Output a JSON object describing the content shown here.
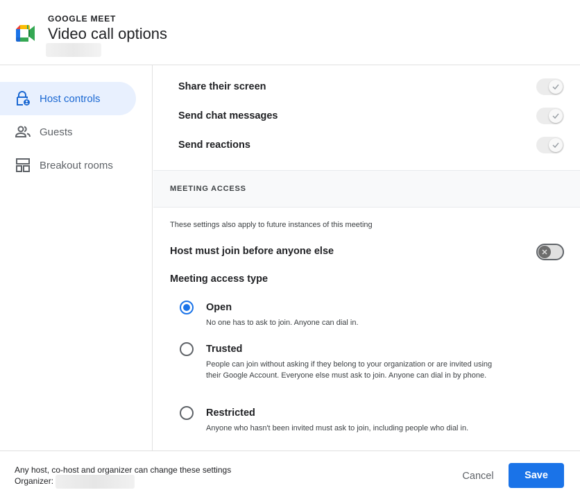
{
  "header": {
    "brand": "GOOGLE MEET",
    "title": "Video call options"
  },
  "sidebar": {
    "items": [
      {
        "label": "Host controls",
        "icon": "lock-person-icon",
        "active": true
      },
      {
        "label": "Guests",
        "icon": "people-icon",
        "active": false
      },
      {
        "label": "Breakout rooms",
        "icon": "grid-icon",
        "active": false
      }
    ]
  },
  "permissions": [
    {
      "label": "Share their screen",
      "enabled": true
    },
    {
      "label": "Send chat messages",
      "enabled": true
    },
    {
      "label": "Send reactions",
      "enabled": true
    }
  ],
  "meeting_access": {
    "section_title": "MEETING ACCESS",
    "note": "These settings also apply to future instances of this meeting",
    "host_join_label": "Host must join before anyone else",
    "host_join_enabled": false,
    "access_type_label": "Meeting access type",
    "options": [
      {
        "label": "Open",
        "desc": "No one has to ask to join. Anyone can dial in.",
        "selected": true
      },
      {
        "label": "Trusted",
        "desc": "People can join without asking if they belong to your organization or are invited using their Google Account. Everyone else must ask to join. Anyone can dial in by phone.",
        "selected": false
      },
      {
        "label": "Restricted",
        "desc": "Anyone who hasn't been invited must ask to join, including people who dial in.",
        "selected": false
      }
    ]
  },
  "footer": {
    "note": "Any host, co-host and organizer can change these settings",
    "organizer_label": "Organizer:",
    "cancel_label": "Cancel",
    "save_label": "Save"
  },
  "colors": {
    "accent": "#1a73e8",
    "active_nav_bg": "#e8f0fe",
    "active_nav_text": "#1967d2"
  }
}
